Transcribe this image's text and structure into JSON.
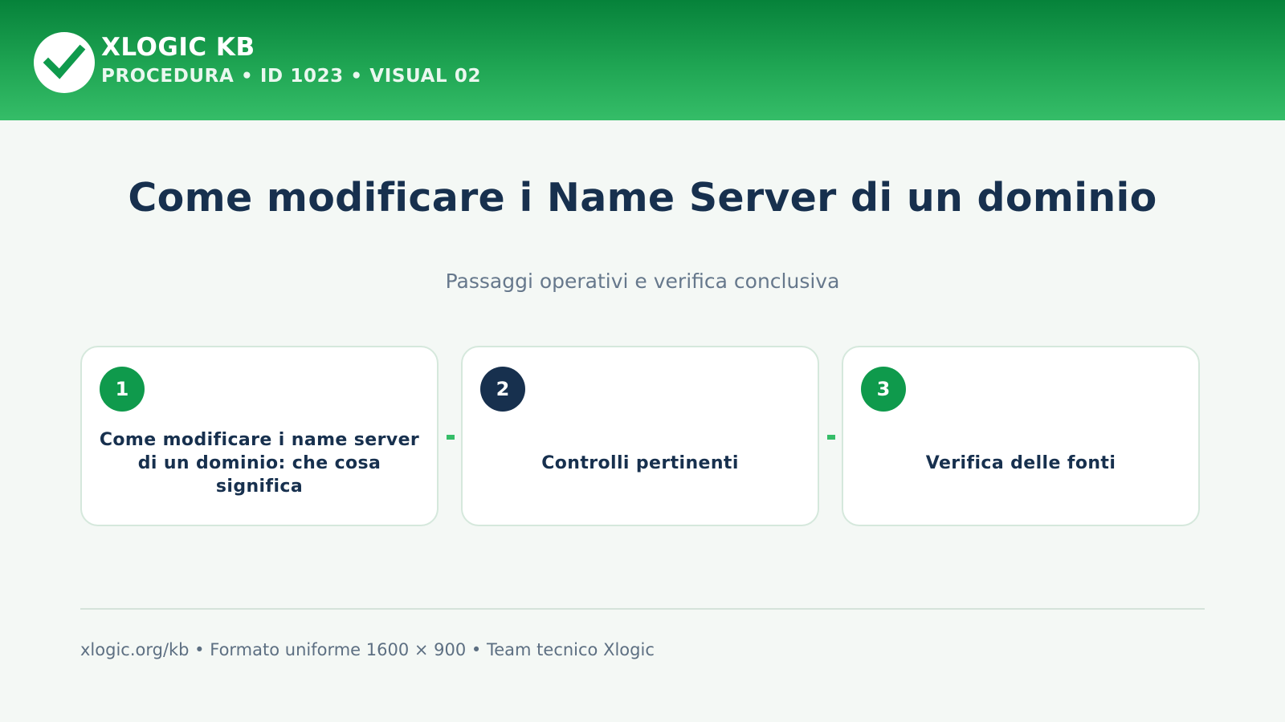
{
  "header": {
    "logo_icon": "checkmark-icon",
    "brand_name": "XLOGIC KB",
    "brand_subtitle": "PROCEDURA • ID 1023 • VISUAL 02"
  },
  "main": {
    "title": "Come modificare i Name Server di un dominio",
    "subtitle": "Passaggi operativi e verifica conclusiva",
    "steps": [
      {
        "number": "1",
        "label": "Come modificare i name server di un dominio: che cosa significa"
      },
      {
        "number": "2",
        "label": "Controlli pertinenti"
      },
      {
        "number": "3",
        "label": "Verifica delle fonti"
      }
    ]
  },
  "footer": {
    "text": "xlogic.org/kb • Formato uniforme 1600 × 900 • Team tecnico Xlogic"
  },
  "colors": {
    "header_green": "#1fa553",
    "accent_green": "#0f9a4c",
    "navy": "#17304e",
    "background": "#f4f8f5"
  }
}
